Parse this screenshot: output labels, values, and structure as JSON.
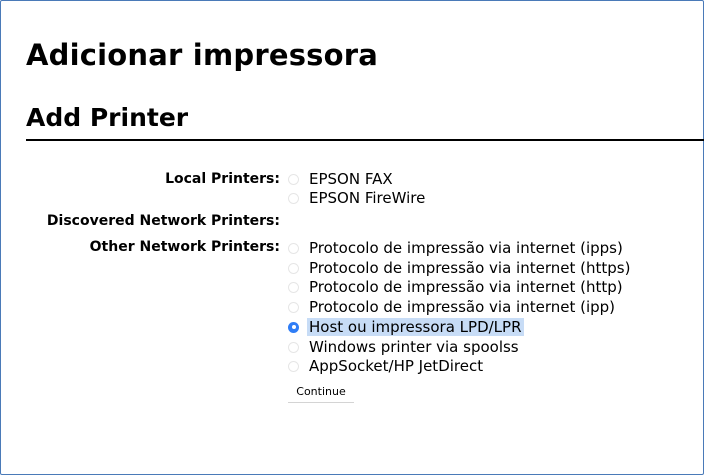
{
  "page": {
    "title_pt": "Adicionar impressora",
    "title_en": "Add Printer"
  },
  "local_printers": {
    "label": "Local Printers:",
    "options": [
      {
        "text": "EPSON FAX",
        "selected": false
      },
      {
        "text": "EPSON FireWire",
        "selected": false
      }
    ]
  },
  "discovered": {
    "label": "Discovered Network Printers:"
  },
  "other_network": {
    "label": "Other Network Printers:",
    "options": [
      {
        "text": "Protocolo de impressão via internet (ipps)",
        "selected": false
      },
      {
        "text": "Protocolo de impressão via internet (https)",
        "selected": false
      },
      {
        "text": "Protocolo de impressão via internet (http)",
        "selected": false
      },
      {
        "text": "Protocolo de impressão via internet (ipp)",
        "selected": false
      },
      {
        "text": "Host ou impressora LPD/LPR",
        "selected": true
      },
      {
        "text": "Windows printer via spoolss",
        "selected": false
      },
      {
        "text": "AppSocket/HP JetDirect",
        "selected": false
      }
    ]
  },
  "actions": {
    "continue_label": "Continue"
  },
  "colors": {
    "accent": "#2f7df6",
    "selection_highlight": "#c7dcf6",
    "frame_border": "#4a7ab8"
  }
}
